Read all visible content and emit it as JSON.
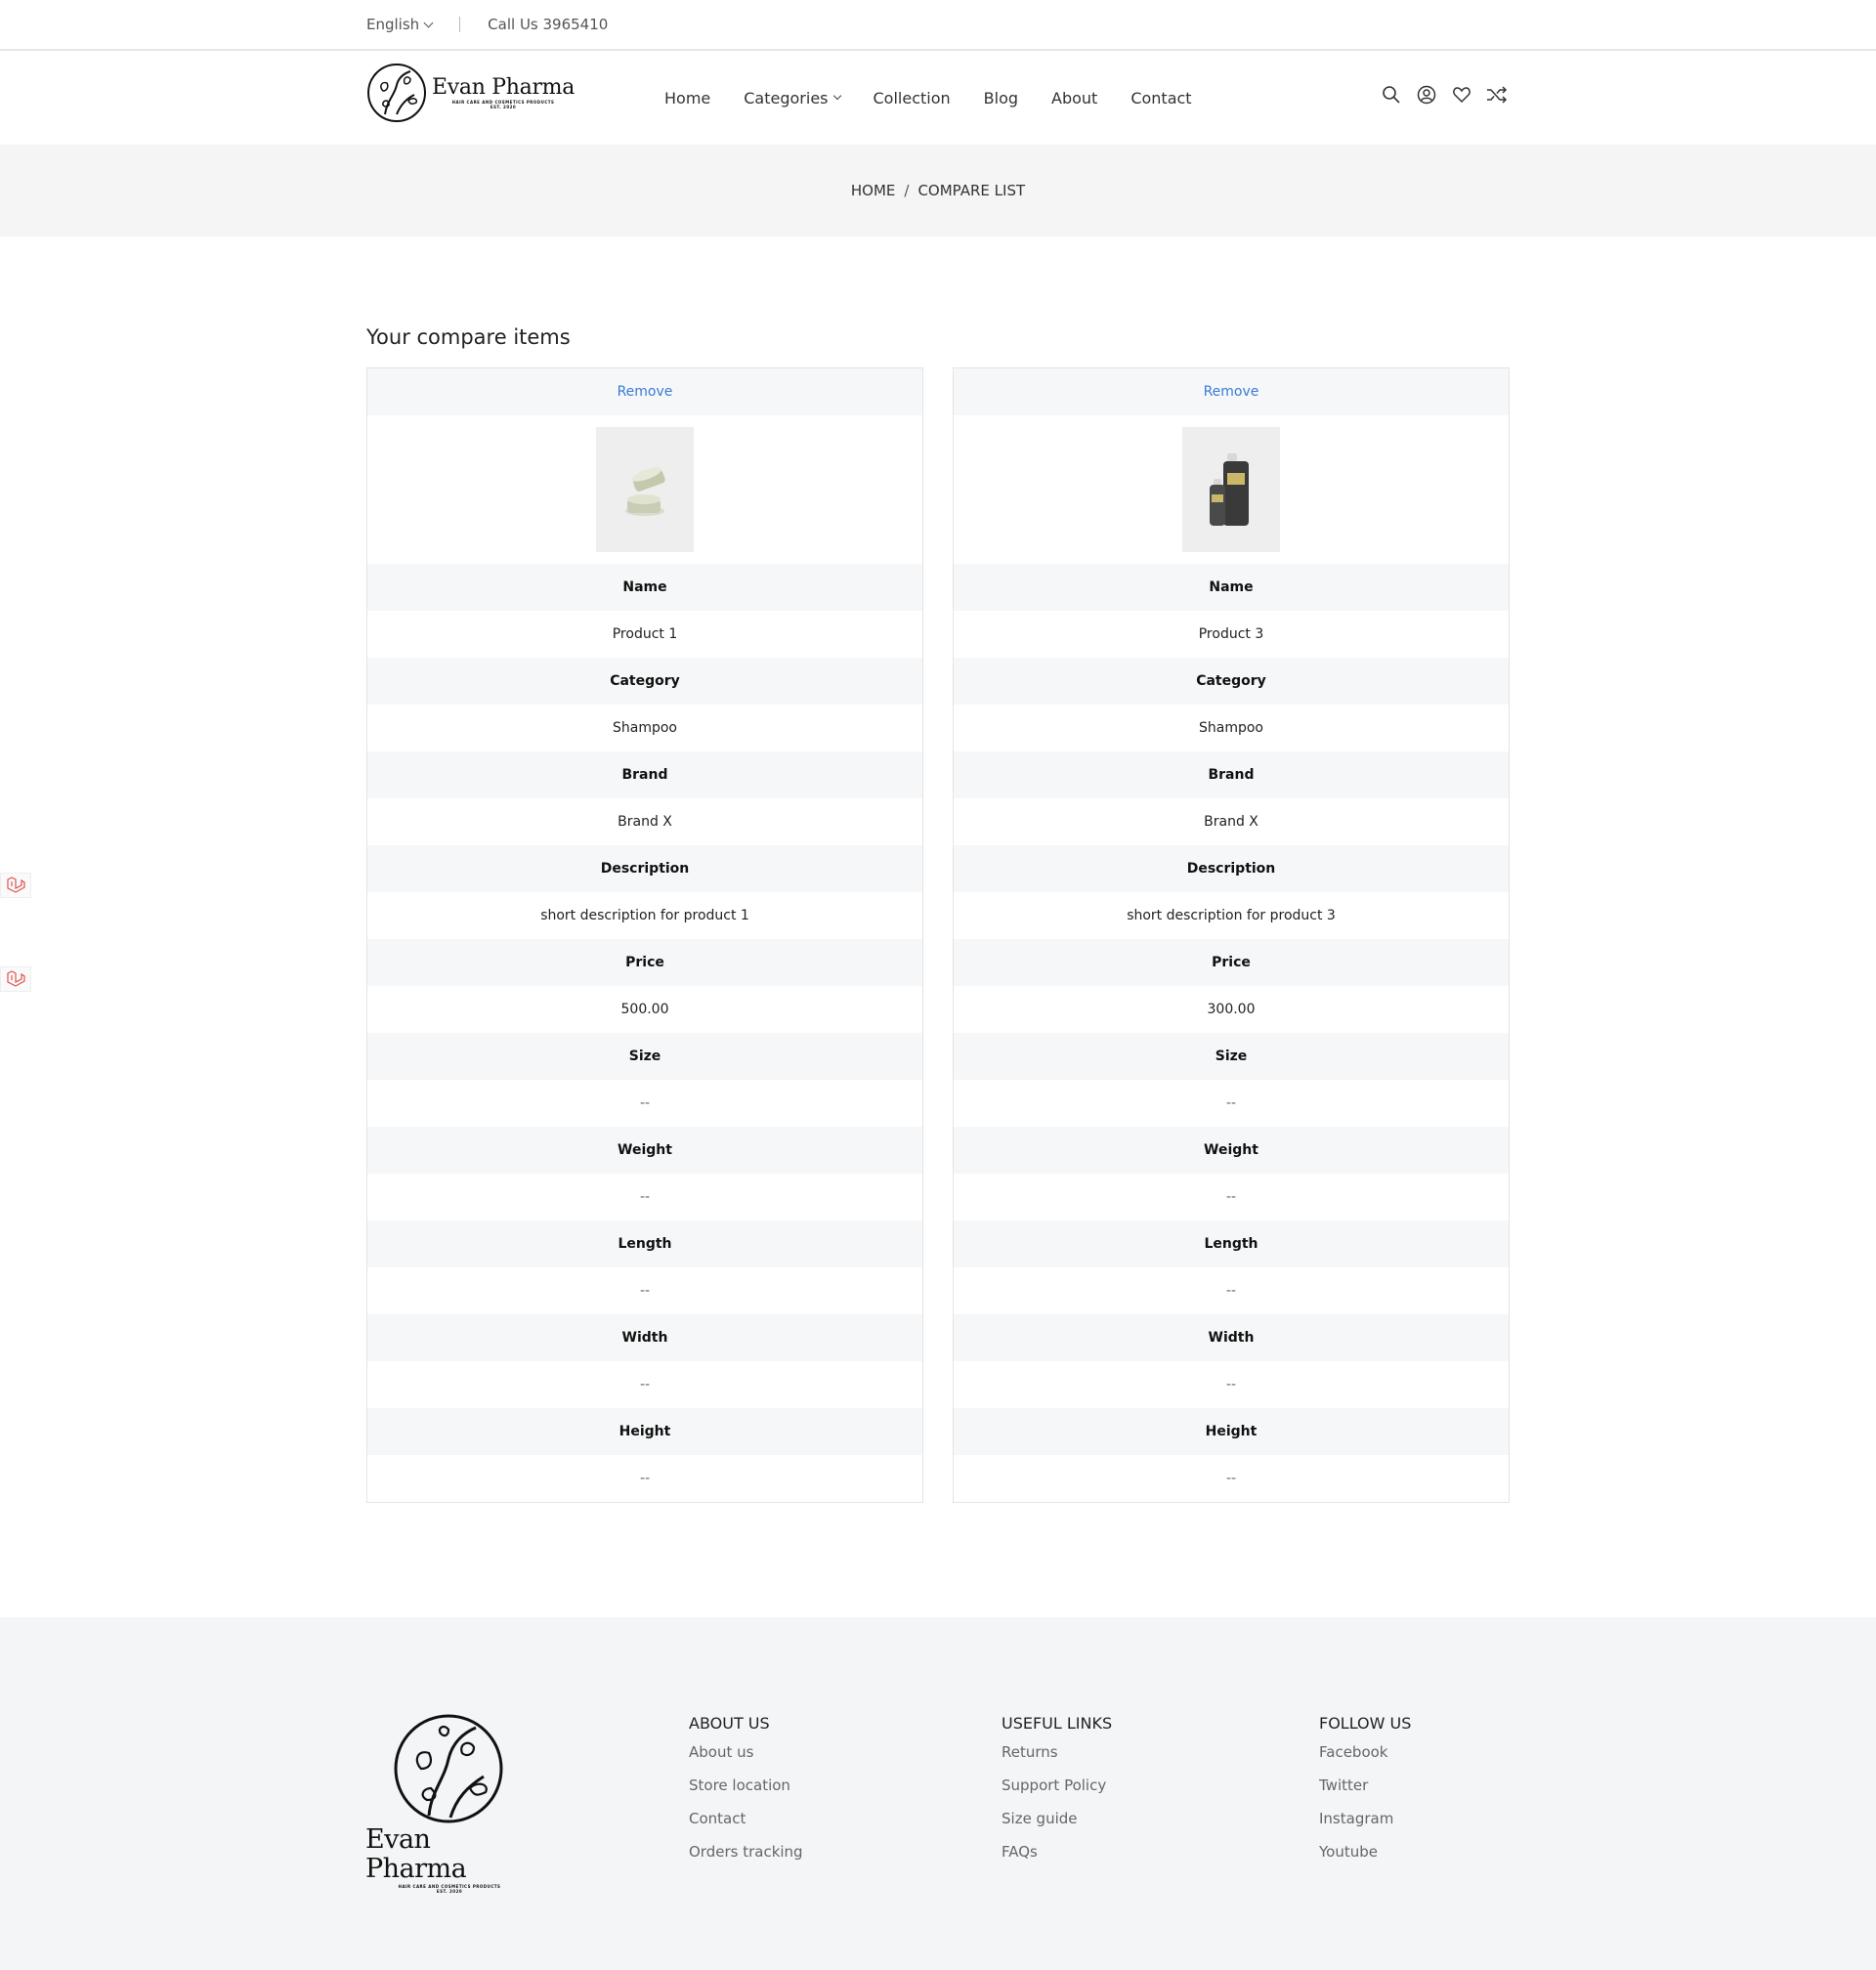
{
  "topbar": {
    "language": "English",
    "phone": "Call Us 3965410"
  },
  "brand": {
    "name": "Evan Pharma",
    "tagline": "HAIR CARE AND COSMETICS PRODUCTS",
    "est": "EST. 2020"
  },
  "nav": {
    "items": [
      "Home",
      "Categories",
      "Collection",
      "Blog",
      "About",
      "Contact"
    ]
  },
  "header_icons": [
    "search-icon",
    "user-icon",
    "heart-icon",
    "shuffle-icon"
  ],
  "breadcrumb": {
    "home": "HOME",
    "separator": "/",
    "current": "COMPARE LIST"
  },
  "compare": {
    "heading": "Your compare items",
    "remove_label": "Remove",
    "labels": {
      "name": "Name",
      "category": "Category",
      "brand": "Brand",
      "description": "Description",
      "price": "Price",
      "size": "Size",
      "weight": "Weight",
      "length": "Length",
      "width": "Width",
      "height": "Height"
    },
    "items": [
      {
        "name": "Product 1",
        "category": "Shampoo",
        "brand": "Brand X",
        "description": "short description for product 1",
        "price": "500.00",
        "size": "--",
        "weight": "--",
        "length": "--",
        "width": "--",
        "height": "--"
      },
      {
        "name": "Product 3",
        "category": "Shampoo",
        "brand": "Brand X",
        "description": "short description for product 3",
        "price": "300.00",
        "size": "--",
        "weight": "--",
        "length": "--",
        "width": "--",
        "height": "--"
      }
    ]
  },
  "footer": {
    "about": {
      "title": "ABOUT US",
      "links": [
        "About us",
        "Store location",
        "Contact",
        "Orders tracking"
      ]
    },
    "useful": {
      "title": "USEFUL LINKS",
      "links": [
        "Returns",
        "Support Policy",
        "Size guide",
        "FAQs"
      ]
    },
    "follow": {
      "title": "FOLLOW US",
      "links": [
        "Facebook",
        "Twitter",
        "Instagram",
        "Youtube"
      ]
    }
  },
  "colors": {
    "link_blue": "#3a7bd5",
    "band_gray": "#f5f5f5",
    "row_gray": "#f6f7f8",
    "badge_red": "#e0524f"
  }
}
